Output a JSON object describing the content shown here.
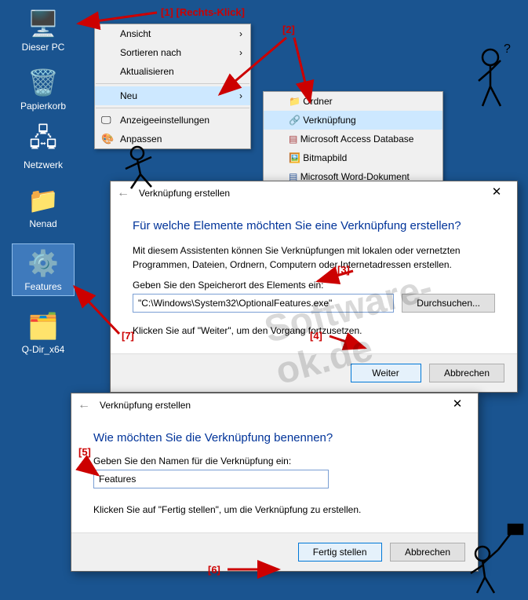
{
  "desktop_icons": {
    "pc": "Dieser PC",
    "trash": "Papierkorb",
    "network": "Netzwerk",
    "folder": "Nenad",
    "features": "Features",
    "qdir": "Q-Dir_x64"
  },
  "context_menu": {
    "view": "Ansicht",
    "sort": "Sortieren nach",
    "refresh": "Aktualisieren",
    "new": "Neu",
    "display": "Anzeigeeinstellungen",
    "customize": "Anpassen"
  },
  "submenu": {
    "folder": "Ordner",
    "shortcut": "Verknüpfung",
    "access": "Microsoft Access Database",
    "bitmap": "Bitmapbild",
    "word": "Microsoft Word-Dokument"
  },
  "dialog1": {
    "title": "Verknüpfung erstellen",
    "heading": "Für welche Elemente möchten Sie eine Verknüpfung erstellen?",
    "desc": "Mit diesem Assistenten können Sie Verknüpfungen mit lokalen oder vernetzten Programmen, Dateien, Ordnern, Computern oder Internetadressen erstellen.",
    "label": "Geben Sie den Speicherort des Elements ein:",
    "value": "\"C:\\Windows\\System32\\OptionalFeatures.exe\"",
    "browse": "Durchsuchen...",
    "hint": "Klicken Sie auf \"Weiter\", um den Vorgang fortzusetzen.",
    "next": "Weiter",
    "cancel": "Abbrechen"
  },
  "dialog2": {
    "title": "Verknüpfung erstellen",
    "heading": "Wie möchten Sie die Verknüpfung benennen?",
    "label": "Geben Sie den Namen für die Verknüpfung ein:",
    "value": "Features",
    "hint": "Klicken Sie auf \"Fertig stellen\", um die Verknüpfung zu erstellen.",
    "finish": "Fertig stellen",
    "cancel": "Abbrechen"
  },
  "annotations": {
    "a1": "[1] [Rechts-Klick]",
    "a2": "[2]",
    "a3": "[3]",
    "a4": "[4]",
    "a5": "[5]",
    "a6": "[6]",
    "a7": "[7]"
  },
  "watermark": "Software-ok.de"
}
